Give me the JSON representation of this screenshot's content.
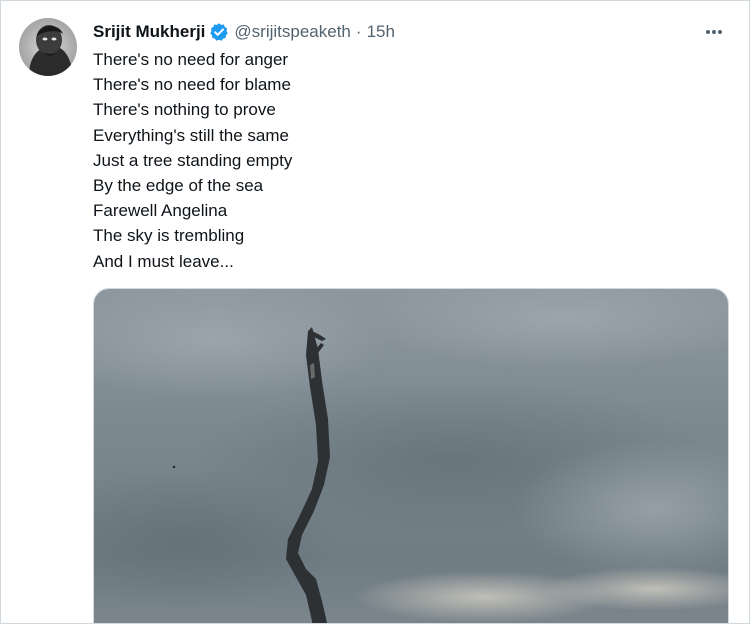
{
  "tweet": {
    "author": {
      "display_name": "Srijit Mukherji",
      "handle": "@srijitspeaketh",
      "verified": true,
      "avatar_icon": "profile-avatar"
    },
    "separator": "·",
    "timestamp": "15h",
    "more_icon": "more-options-icon",
    "text_lines": [
      "There's no need for anger",
      "There's no need for blame",
      "There's nothing to prove",
      "Everything's still the same",
      "Just a tree standing empty",
      "By the edge of the sea",
      "Farewell Angelina",
      "The sky is trembling",
      "And I must leave..."
    ],
    "media": {
      "type": "photo",
      "subject": "bare-tree-trunk-under-cloudy-sky"
    }
  },
  "colors": {
    "primary_text": "#0f1419",
    "secondary_text": "#536471",
    "verified_blue": "#1d9bf0",
    "border": "#cfd9de"
  }
}
